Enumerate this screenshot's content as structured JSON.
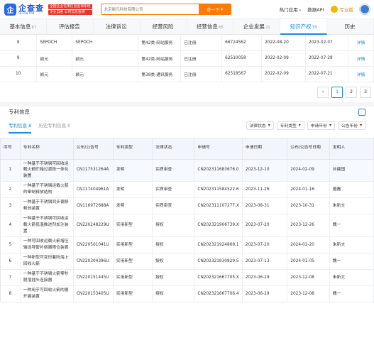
{
  "header": {
    "logo_text": "企查查",
    "logo_sub": "Qi Cha Cha",
    "slogan_1": "全国企业信用信息查询系统",
    "slogan_2": "企业自查 公司信息查询",
    "search_placeholder": "北京颖元科技有限公司",
    "search_button": "查一下",
    "hot_apps": "热门应用",
    "data_api": "数据API",
    "vip_label": "专业版"
  },
  "tabs": [
    {
      "label": "基本信息",
      "count": "67"
    },
    {
      "label": "评估报告",
      "count": ""
    },
    {
      "label": "法律诉讼",
      "count": ""
    },
    {
      "label": "经营风险",
      "count": ""
    },
    {
      "label": "经营信息",
      "count": "65"
    },
    {
      "label": "企业发展",
      "count": "21"
    },
    {
      "label": "知识产权",
      "count": "33"
    },
    {
      "label": "历史",
      "count": ""
    }
  ],
  "trademark_rows": [
    {
      "no": "8",
      "image": "SEPOCH",
      "name": "SEPOCH",
      "category": "第42类-网站服务",
      "status": "已注册",
      "reg_no": "66724562",
      "apply_date": "2022-08-20",
      "reg_date": "2023-02-07",
      "action": "详情"
    },
    {
      "no": "9",
      "image": "颖元",
      "name": "颖元",
      "category": "第42类-网站服务",
      "status": "已注册",
      "reg_no": "62510058",
      "apply_date": "2022-02-09",
      "reg_date": "2022-07-28",
      "action": "详情"
    },
    {
      "no": "10",
      "image": "颖元",
      "name": "颖元",
      "category": "第38类-通讯服务",
      "status": "已注册",
      "reg_no": "62518567",
      "apply_date": "2022-02-09",
      "reg_date": "2022-07-21",
      "action": "详情"
    }
  ],
  "pager": {
    "prev": "‹",
    "p1": "1",
    "p2": "2",
    "p3": "3"
  },
  "patent_section": {
    "title": "专利信息",
    "subtab_active": "专利信息 8",
    "subtab_history": "历史专利信息 0",
    "filters": [
      "法律状态",
      "专利类型",
      "申请年份",
      "公告年份"
    ],
    "headers": [
      "序号",
      "专利名称",
      "公布/公告号",
      "专利类型",
      "法律状态",
      "申请号",
      "申请日期",
      "公布/公告号日期",
      "发明人"
    ]
  },
  "patents": [
    {
      "no": "1",
      "name": "一种基于不锈钢可回收运载火箭贮箱过渡段一体化装置",
      "pub_no": "CN117531264A",
      "type": "发明",
      "status": "实质审查",
      "app_no": "CN202311683676.0",
      "app_date": "2023-12-10",
      "pub_date": "2024-02-09",
      "inventor": "孙建国"
    },
    {
      "no": "2",
      "name": "一种基于不锈钢运载火箭的牵制释放结构",
      "pub_no": "CN117404961A",
      "type": "发明",
      "status": "实质审查",
      "app_no": "CN202311584522.6",
      "app_date": "2023-11-26",
      "pub_date": "2024-01-16",
      "inventor": "唐磊"
    },
    {
      "no": "3",
      "name": "一种基于不锈钢同步偏移释放装置",
      "pub_no": "CN116972688A",
      "type": "发明",
      "status": "实质审查",
      "app_no": "CN202311107277.X",
      "app_date": "2023-08-31",
      "pub_date": "2023-10-31",
      "inventor": "朱新文"
    },
    {
      "no": "4",
      "name": "一种基于不锈钢可回收运载火箭低温推进剂加注装置",
      "pub_no": "CN220248229U",
      "type": "实用新型",
      "status": "授权",
      "app_no": "CN202321906739.X",
      "app_date": "2023-07-20",
      "pub_date": "2023-12-26",
      "inventor": "魏一"
    },
    {
      "no": "5",
      "name": "一种可回收运载火箭增压输送导管补偿器限位装置",
      "pub_no": "CN220501041U",
      "type": "实用新型",
      "status": "授权",
      "app_no": "CN202321924868.1",
      "app_date": "2023-07-20",
      "pub_date": "2024-02-20",
      "inventor": "朱新文"
    },
    {
      "no": "6",
      "name": "一种新型可变形着陆海上回收火箭",
      "pub_no": "CN220304396U",
      "type": "实用新型",
      "status": "授权",
      "app_no": "CN202321830829.5",
      "app_date": "2023-07-13",
      "pub_date": "2024-01-05",
      "inventor": "魏一"
    },
    {
      "no": "7",
      "name": "一种基于不锈钢火箭零秒脱落插头连接器",
      "pub_no": "CN220151445U",
      "type": "实用新型",
      "status": "授权",
      "app_no": "CN202321667705.X",
      "app_date": "2023-06-29",
      "pub_date": "2023-12-08",
      "inventor": "朱新文"
    },
    {
      "no": "8",
      "name": "一种用于可回收火箭的展开翼装置",
      "pub_no": "CN220153405U",
      "type": "实用新型",
      "status": "授权",
      "app_no": "CN202321667706.4",
      "app_date": "2023-06-29",
      "pub_date": "2023-12-08",
      "inventor": "魏一"
    }
  ],
  "colors": {
    "accent": "#128bed",
    "orange": "#ff7a00",
    "red": "#e9332c"
  }
}
